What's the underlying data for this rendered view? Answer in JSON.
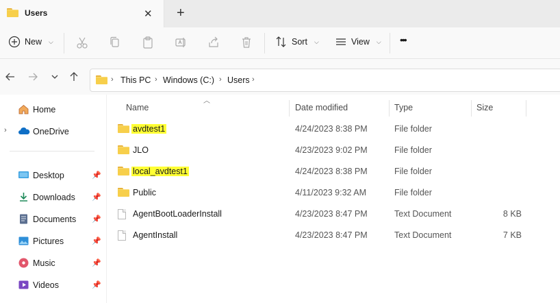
{
  "window": {
    "tab_title": "Users",
    "tab_close": "✕",
    "tab_add": "+"
  },
  "toolbar": {
    "new_label": "New",
    "sort_label": "Sort",
    "view_label": "View",
    "more_label": "•••"
  },
  "address": {
    "crumbs": [
      "This PC",
      "Windows (C:)",
      "Users"
    ]
  },
  "sidebar": {
    "items": [
      {
        "label": "Home",
        "icon": "home-icon"
      },
      {
        "label": "OneDrive",
        "icon": "cloud-icon"
      },
      {
        "label": "Desktop",
        "icon": "desktop-icon"
      },
      {
        "label": "Downloads",
        "icon": "download-icon"
      },
      {
        "label": "Documents",
        "icon": "documents-icon"
      },
      {
        "label": "Pictures",
        "icon": "pictures-icon"
      },
      {
        "label": "Music",
        "icon": "music-icon"
      },
      {
        "label": "Videos",
        "icon": "videos-icon"
      }
    ]
  },
  "columns": {
    "name": "Name",
    "date": "Date modified",
    "type": "Type",
    "size": "Size"
  },
  "files": [
    {
      "name": "avdtest1",
      "date": "4/24/2023 8:38 PM",
      "type": "File folder",
      "size": "",
      "kind": "folder",
      "highlight": true
    },
    {
      "name": "JLO",
      "date": "4/23/2023 9:02 PM",
      "type": "File folder",
      "size": "",
      "kind": "folder",
      "highlight": false
    },
    {
      "name": "local_avdtest1",
      "date": "4/24/2023 8:38 PM",
      "type": "File folder",
      "size": "",
      "kind": "folder",
      "highlight": true
    },
    {
      "name": "Public",
      "date": "4/11/2023 9:32 AM",
      "type": "File folder",
      "size": "",
      "kind": "folder",
      "highlight": false
    },
    {
      "name": "AgentBootLoaderInstall",
      "date": "4/23/2023 8:47 PM",
      "type": "Text Document",
      "size": "8 KB",
      "kind": "text-file",
      "highlight": false
    },
    {
      "name": "AgentInstall",
      "date": "4/23/2023 8:47 PM",
      "type": "Text Document",
      "size": "7 KB",
      "kind": "text-file",
      "highlight": false
    }
  ],
  "colors": {
    "highlight": "#ffff33",
    "folder": "#f7cf4b",
    "accent": "#0067c0"
  }
}
